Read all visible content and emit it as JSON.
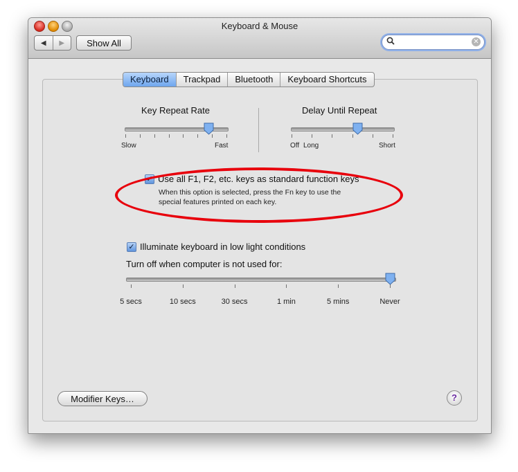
{
  "window": {
    "title": "Keyboard & Mouse"
  },
  "toolbar": {
    "back_glyph": "◀",
    "forward_glyph": "▶",
    "show_all_label": "Show All"
  },
  "search": {
    "value": "",
    "placeholder": "",
    "clear_glyph": "✕"
  },
  "tabs": [
    {
      "label": "Keyboard",
      "active": true
    },
    {
      "label": "Trackpad",
      "active": false
    },
    {
      "label": "Bluetooth",
      "active": false
    },
    {
      "label": "Keyboard Shortcuts",
      "active": false
    }
  ],
  "key_repeat": {
    "label": "Key Repeat Rate",
    "min_label": "Slow",
    "max_label": "Fast",
    "value_fraction": 0.82
  },
  "delay_repeat": {
    "label": "Delay Until Repeat",
    "off_label": "Off",
    "min_label": "Long",
    "max_label": "Short",
    "value_fraction": 0.65
  },
  "function_keys": {
    "checked": true,
    "label": "Use all F1, F2, etc. keys as standard function keys",
    "description_line1": "When this option is selected, press the Fn key to use the",
    "description_line2": "special features printed on each key."
  },
  "illuminate": {
    "checked": true,
    "label": "Illuminate keyboard in low light conditions",
    "turn_off_label": "Turn off when computer is not used for:",
    "stops": [
      "5 secs",
      "10 secs",
      "30 secs",
      "1 min",
      "5 mins",
      "Never"
    ],
    "selected": "Never"
  },
  "footer": {
    "modifier_keys_label": "Modifier Keys…",
    "help_glyph": "?"
  },
  "colors": {
    "annotation": "#e8000c",
    "selected_tab": "#6ea6ee",
    "checkbox": "#5f94dc"
  }
}
